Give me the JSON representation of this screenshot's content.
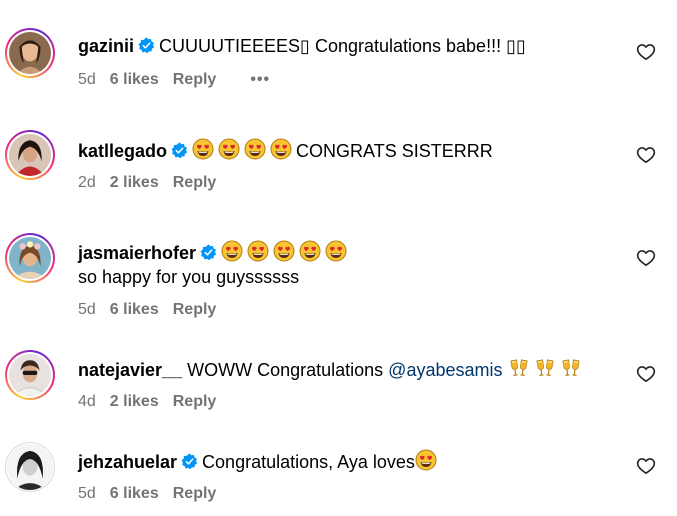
{
  "comments": [
    {
      "username": "gazinii",
      "text": "CUUUUTIEEEES▯ Congratulations babe!!! ▯▯",
      "age": "5d",
      "likes": "6 likes",
      "reply": "Reply",
      "more": "•••"
    },
    {
      "username": "katllegado",
      "text": "CONGRATS SISTERRR",
      "age": "2d",
      "likes": "2 likes",
      "reply": "Reply"
    },
    {
      "username": "jasmaierhofer",
      "text": "so happy for you guyssssss",
      "age": "5d",
      "likes": "6 likes",
      "reply": "Reply"
    },
    {
      "username": "natejavier__",
      "text": "WOWW Congratulations",
      "mention": "@ayabesamis",
      "age": "4d",
      "likes": "2 likes",
      "reply": "Reply"
    },
    {
      "username": "jehzahuelar",
      "text": "Congratulations, Aya loves",
      "age": "5d",
      "likes": "6 likes",
      "reply": "Reply"
    }
  ],
  "icons": {
    "verified": "verified-badge-icon",
    "like": "heart-outline-icon",
    "emoji_face": "heart-eyes-emoji",
    "emoji_glass": "clinking-glasses-emoji"
  },
  "colors": {
    "meta": "#737373",
    "verified": "#0095f6",
    "mention": "#00376b"
  }
}
